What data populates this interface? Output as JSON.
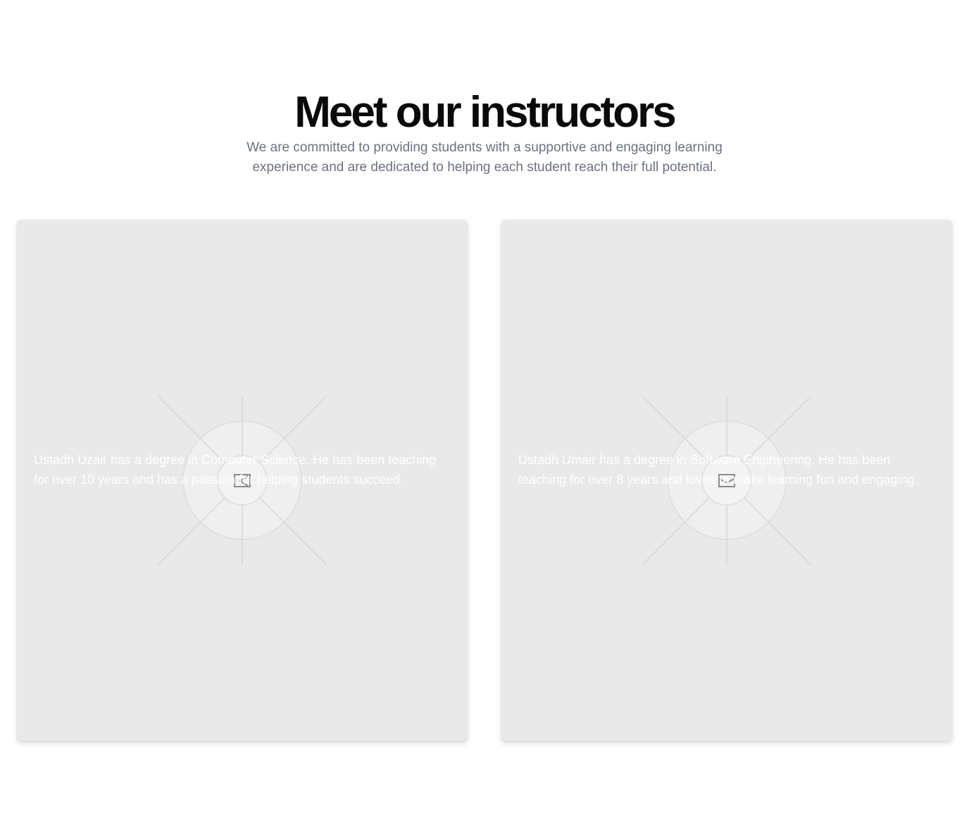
{
  "section": {
    "title": "Meet our instructors",
    "subtitle": "We are committed to providing students with a supportive and engaging learning experience and are dedicated to helping each student reach their full potential."
  },
  "instructors": [
    {
      "bio": "Ustadh Uzair has a degree in Computer Science. He has been teaching for over 10 years and has a passion for helping students succeed.",
      "image_icon": "image-placeholder-icon"
    },
    {
      "bio": "Ustadh Umair has a degree in Software Engineering. He has been teaching for over 8 years and loves to make learning fun and engaging.",
      "image_icon": "image-placeholder-icon"
    }
  ],
  "colors": {
    "card_background": "#e9e9e9",
    "heading": "#0a0a0a",
    "subtitle": "#6b7280",
    "bio_text": "#ffffff"
  }
}
